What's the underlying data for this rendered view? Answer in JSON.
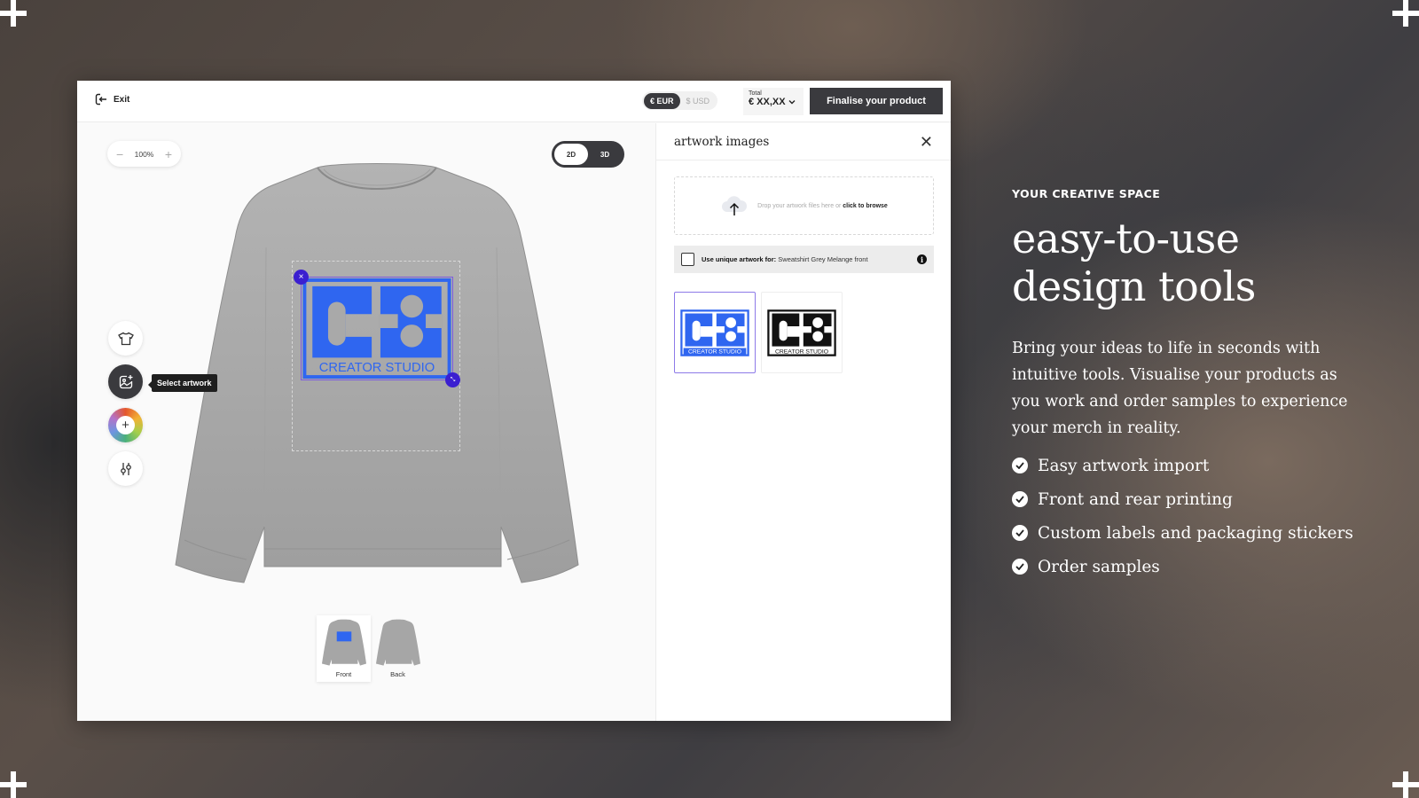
{
  "topbar": {
    "exit_label": "Exit",
    "currency_options": [
      {
        "label": "€ EUR",
        "active": true
      },
      {
        "label": "$ USD",
        "active": false
      }
    ],
    "total_label": "Total",
    "total_value": "€ XX,XX",
    "finalise_label": "Finalise your product"
  },
  "canvas": {
    "zoom_level": "100%",
    "view_modes": [
      {
        "label": "2D",
        "active": true
      },
      {
        "label": "3D",
        "active": false
      }
    ],
    "tools": [
      {
        "name": "product",
        "icon": "tshirt-icon"
      },
      {
        "name": "select-artwork",
        "icon": "image-add-icon",
        "active": true
      },
      {
        "name": "add-color",
        "icon": "plus-icon"
      },
      {
        "name": "adjustments",
        "icon": "sliders-icon"
      }
    ],
    "tooltip": "Select artwork",
    "artwork_brand": {
      "monogram": "CS",
      "wordmark": "CREATOR STUDIO",
      "color": "#2f66f0"
    },
    "garment_color": "#a9a9a9",
    "accent_handle_color": "#3b1fd0",
    "views": [
      {
        "label": "Front",
        "active": true
      },
      {
        "label": "Back",
        "active": false
      }
    ]
  },
  "panel": {
    "title": "artwork images",
    "dropzone_text": "Drop your artwork files here or ",
    "dropzone_link": "click to browse",
    "unique_label": "Use unique artwork for:",
    "unique_target": " Sweatshirt Grey Melange front",
    "unique_checked": false,
    "artworks": [
      {
        "name": "CS logo blue",
        "color": "#2f66f0",
        "selected": true
      },
      {
        "name": "CS logo black",
        "color": "#111111",
        "selected": false
      }
    ]
  },
  "marketing": {
    "eyebrow": "YOUR CREATIVE SPACE",
    "headline_line1": "easy-to-use",
    "headline_line2": "design tools",
    "lede": "Bring your ideas to life in seconds with intuitive tools. Visualise your products as you work and order samples to experience your merch in reality.",
    "features": [
      "Easy artwork import",
      "Front and rear printing",
      "Custom labels and packaging stickers",
      "Order samples"
    ]
  }
}
